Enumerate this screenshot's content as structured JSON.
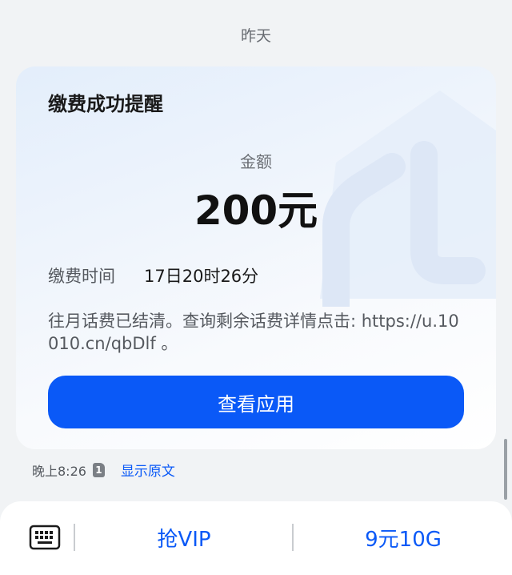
{
  "conversation": {
    "date_separator": "昨天"
  },
  "message_card": {
    "title": "缴费成功提醒",
    "amount_label": "金额",
    "amount_value": "200元",
    "pay_time_label": "缴费时间",
    "pay_time_value": "17日20时26分",
    "body_text": "往月话费已结清。查询剩余话费详情点击: https://u.10010.cn/qbDlf 。",
    "button_label": "查看应用"
  },
  "message_meta": {
    "time": "晚上8:26",
    "sim_badge": "1",
    "show_original": "显示原文"
  },
  "bottom_bar": {
    "keyboard_icon": "keyboard-icon",
    "actions": [
      {
        "label": "抢VIP"
      },
      {
        "label": "9元10G"
      }
    ]
  },
  "colors": {
    "accent": "#0a59f7",
    "background": "#f1f3f5"
  }
}
